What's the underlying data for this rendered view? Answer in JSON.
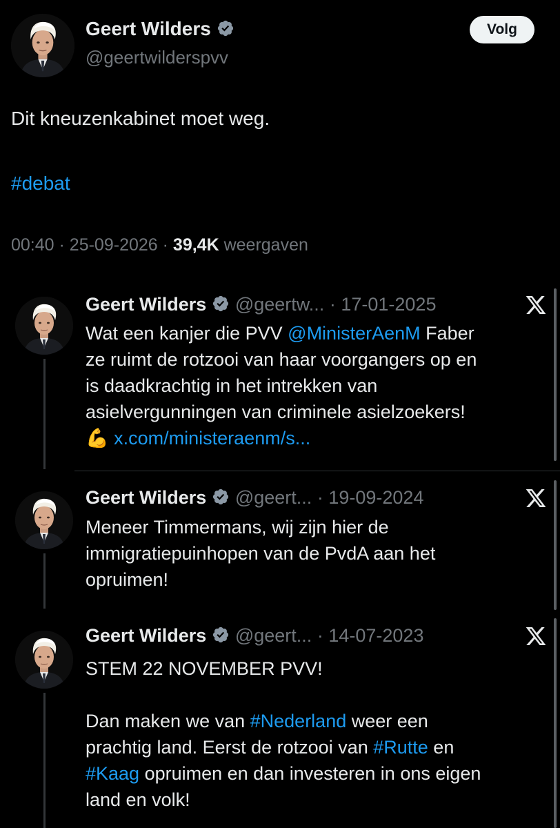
{
  "header": {
    "name": "Geert Wilders",
    "handle": "@geertwilderspvv",
    "follow_label": "Volg"
  },
  "post": {
    "text": "Dit kneuzenkabinet moet weg.",
    "hashtag": "#debat",
    "time": "00:40",
    "date": "25-09-2026",
    "views_count": "39,4K",
    "views_label": "weergaven",
    "dot": "·"
  },
  "quotes": [
    {
      "name": "Geert Wilders",
      "handle": "@geertw...",
      "date": "17-01-2025",
      "line1_pre": "Wat een kanjer die PVV ",
      "line1_link": "@MinisterAenM",
      "line1_post": " Faber",
      "line2": "ze ruimt de rotzooi van haar voorgangers op en",
      "line3": "is daadkrachtig in het intrekken van",
      "line4": "asielvergunningen van criminele asielzoekers!",
      "emoji": "💪",
      "url": "x.com/ministeraenm/s..."
    },
    {
      "name": "Geert Wilders",
      "handle": "@geert...",
      "date": "19-09-2024",
      "line1": "Meneer Timmermans, wij zijn hier de",
      "line2": "immigratiepuinhopen van de PvdA aan het",
      "line3": "opruimen!"
    },
    {
      "name": "Geert Wilders",
      "handle": "@geert...",
      "date": "14-07-2023",
      "line1": "STEM 22 NOVEMBER PVV!",
      "line2_pre": "Dan maken we van ",
      "line2_link": "#Nederland",
      "line2_post": " weer een",
      "line3_pre": "prachtig land. Eerst de rotzooi van ",
      "line3_link": "#Rutte",
      "line3_post": " en",
      "line4_link": "#Kaag",
      "line4_post": " opruimen en dan investeren in ons eigen",
      "line5": "land en volk!"
    }
  ],
  "colors": {
    "background": "#000000",
    "text": "#e7e9ea",
    "muted": "#71767b",
    "link": "#1d9bf0",
    "verified": "#8b98a5"
  },
  "icons": {
    "verified": "verified-badge-icon",
    "x_logo": "x-logo-icon"
  }
}
